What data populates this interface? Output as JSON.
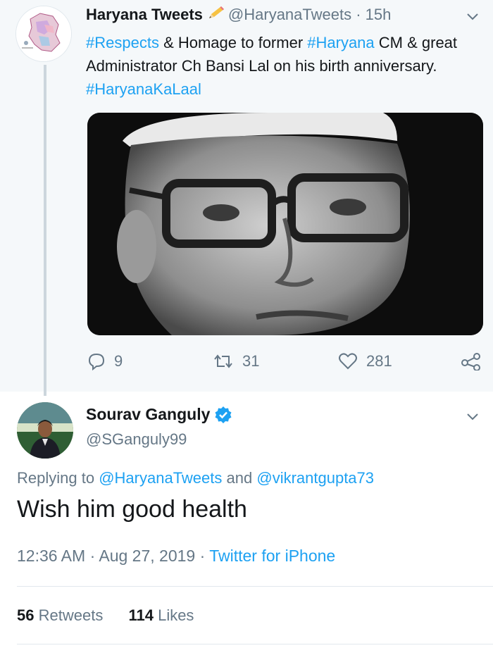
{
  "parent_tweet": {
    "author_name": "Haryana Tweets",
    "handle": "@HaryanaTweets",
    "time": "· 15h",
    "text_parts": [
      {
        "text": "#Respects",
        "link": true
      },
      {
        "text": " & Homage to former ",
        "link": false
      },
      {
        "text": "#Haryana",
        "link": true
      },
      {
        "text": " CM & great Administrator Ch Bansi Lal on his birth anniversary. ",
        "link": false
      },
      {
        "text": "#HaryanaKaLaal",
        "link": true
      }
    ],
    "counts": {
      "replies": "9",
      "retweets": "31",
      "likes": "281"
    }
  },
  "reply_tweet": {
    "author_name": "Sourav Ganguly",
    "handle": "@SGanguly99",
    "replying_prefix": "Replying to",
    "replying_to_1": "@HaryanaTweets",
    "replying_and": "and",
    "replying_to_2": "@vikrantgupta73",
    "text": "Wish him good health",
    "timestamp": "12:36 AM · Aug 27, 2019 ·",
    "source": "Twitter for iPhone",
    "retweet_count": "56",
    "retweet_label": "Retweets",
    "like_count": "114",
    "like_label": "Likes"
  },
  "colors": {
    "link": "#1da1f2",
    "muted": "#657786",
    "verified": "#1da1f2",
    "parent_bg": "#f5f8fa"
  },
  "icons": [
    "pencil-emoji-icon",
    "chevron-down-icon",
    "reply-icon",
    "retweet-icon",
    "like-icon",
    "share-icon",
    "verified-badge-icon"
  ]
}
